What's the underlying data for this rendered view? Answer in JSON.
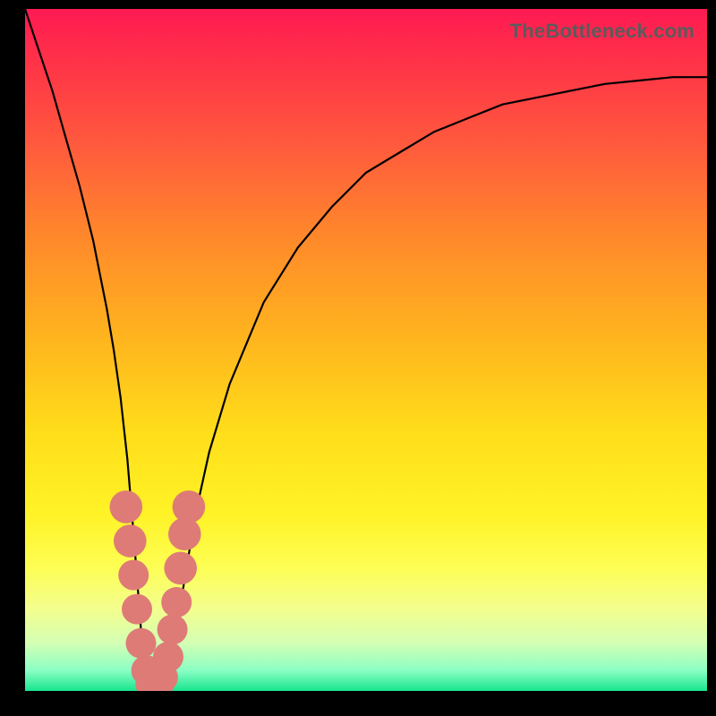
{
  "watermark": "TheBottleneck.com",
  "chart_data": {
    "type": "line",
    "title": "",
    "xlabel": "",
    "ylabel": "",
    "xlim": [
      0,
      100
    ],
    "ylim": [
      0,
      100
    ],
    "grid": false,
    "legend": false,
    "series": [
      {
        "name": "bottleneck-curve",
        "x": [
          0,
          2,
          4,
          6,
          8,
          10,
          12,
          13,
          14,
          15,
          16,
          17,
          18,
          19,
          20,
          21,
          22,
          23,
          24,
          25,
          27,
          30,
          35,
          40,
          45,
          50,
          55,
          60,
          65,
          70,
          75,
          80,
          85,
          90,
          95,
          100
        ],
        "y": [
          100,
          94,
          88,
          81,
          74,
          66,
          56,
          50,
          43,
          34,
          22,
          9,
          2,
          0,
          1,
          3,
          8,
          14,
          20,
          26,
          35,
          45,
          57,
          65,
          71,
          76,
          79,
          82,
          84,
          86,
          87,
          88,
          89,
          89.5,
          90,
          90
        ]
      }
    ],
    "markers": [
      {
        "x": 14.8,
        "y": 27,
        "r": 1.8
      },
      {
        "x": 15.4,
        "y": 22,
        "r": 1.8
      },
      {
        "x": 15.9,
        "y": 17,
        "r": 1.6
      },
      {
        "x": 16.4,
        "y": 12,
        "r": 1.6
      },
      {
        "x": 17.0,
        "y": 7,
        "r": 1.6
      },
      {
        "x": 17.8,
        "y": 3,
        "r": 1.6
      },
      {
        "x": 18.6,
        "y": 1,
        "r": 1.8
      },
      {
        "x": 19.4,
        "y": 1,
        "r": 1.8
      },
      {
        "x": 20.2,
        "y": 2,
        "r": 1.6
      },
      {
        "x": 21.0,
        "y": 5,
        "r": 1.6
      },
      {
        "x": 21.6,
        "y": 9,
        "r": 1.6
      },
      {
        "x": 22.2,
        "y": 13,
        "r": 1.6
      },
      {
        "x": 22.8,
        "y": 18,
        "r": 1.8
      },
      {
        "x": 23.4,
        "y": 23,
        "r": 1.8
      },
      {
        "x": 24.0,
        "y": 27,
        "r": 1.8
      }
    ],
    "background_gradient": {
      "top": "#ff1a52",
      "mid": "#ffdd1a",
      "bottom": "#18e58e"
    }
  }
}
